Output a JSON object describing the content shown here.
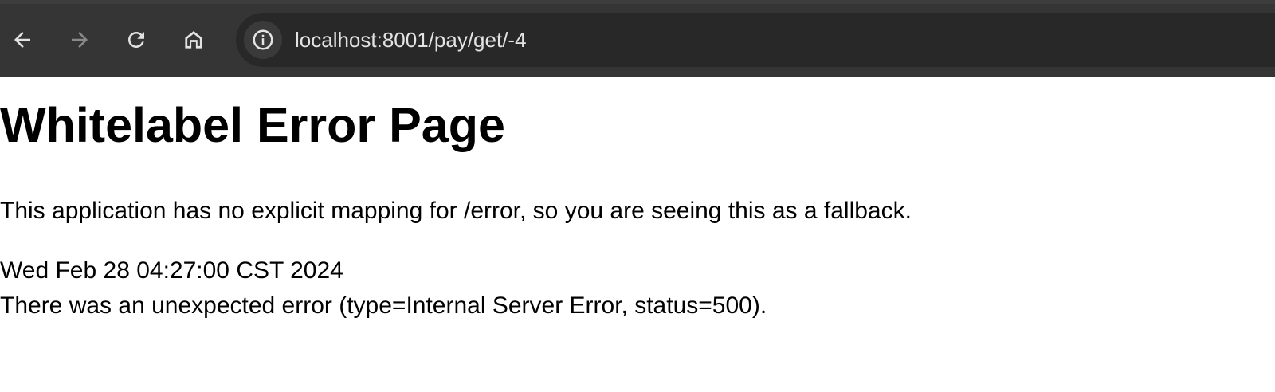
{
  "browser": {
    "address_bar": {
      "url": "localhost:8001/pay/get/-4",
      "site_info_icon": "info-circle-icon"
    },
    "nav_icons": {
      "back": "arrow-left-icon",
      "forward": "arrow-right-icon",
      "reload": "reload-icon",
      "home": "home-icon"
    },
    "forward_enabled": false
  },
  "page": {
    "title": "Whitelabel Error Page",
    "message": "This application has no explicit mapping for /error, so you are seeing this as a fallback.",
    "timestamp": "Wed Feb 28 04:27:00 CST 2024",
    "error_detail": "There was an unexpected error (type=Internal Server Error, status=500)."
  },
  "colors": {
    "chrome_background": "#353535",
    "omnibox_background": "#282828",
    "icon_active": "#e3e3e3",
    "icon_disabled": "#8a8a8a",
    "page_background": "#ffffff",
    "page_text": "#000000"
  }
}
